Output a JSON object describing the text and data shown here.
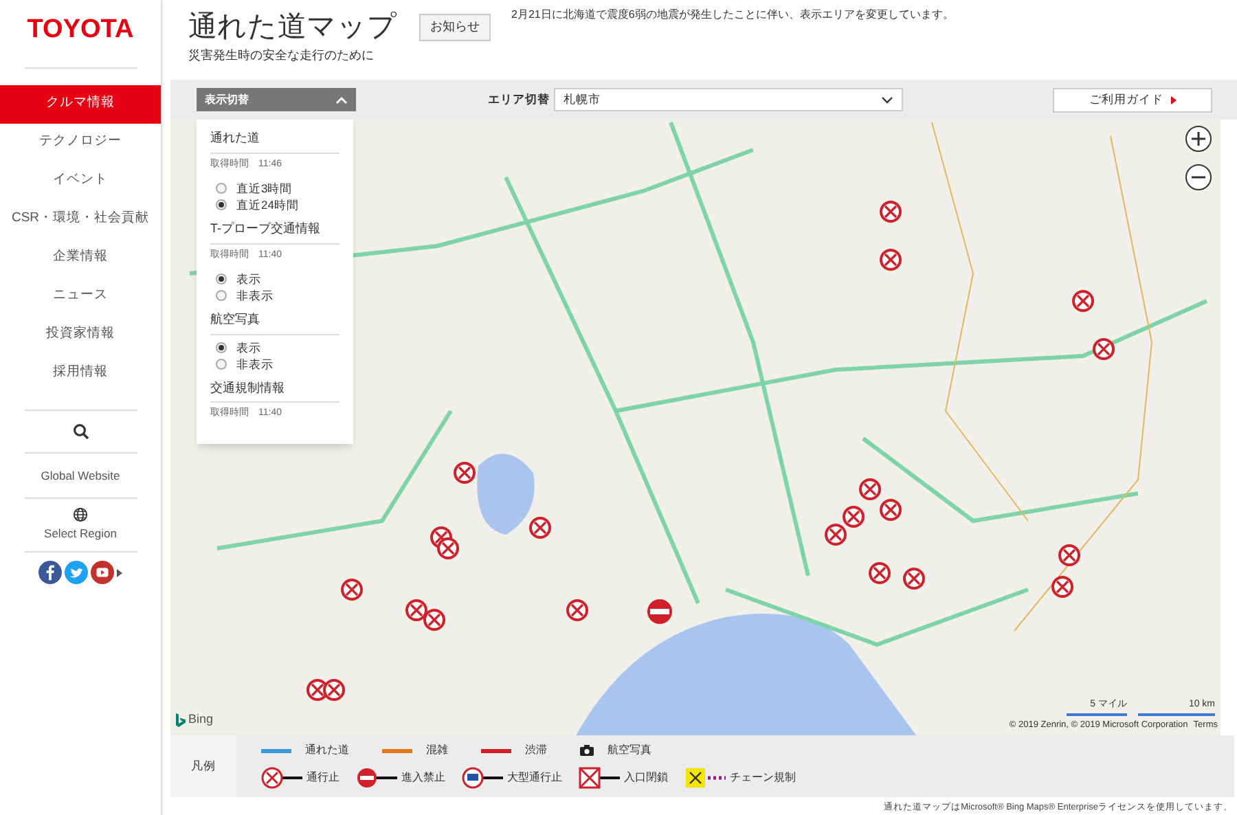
{
  "sidebar": {
    "logo": "TOYOTA",
    "items": [
      {
        "label": "クルマ情報",
        "selected": true
      },
      {
        "label": "テクノロジー",
        "selected": false
      },
      {
        "label": "イベント",
        "selected": false
      },
      {
        "label": "CSR・環境・社会貢献",
        "selected": false
      },
      {
        "label": "企業情報",
        "selected": false
      },
      {
        "label": "ニュース",
        "selected": false
      },
      {
        "label": "投資家情報",
        "selected": false
      },
      {
        "label": "採用情報",
        "selected": false
      }
    ],
    "global_website": "Global Website",
    "select_region": "Select Region"
  },
  "header": {
    "title": "通れた道マップ",
    "subtitle": "災害発生時の安全な走行のために",
    "notice_button": "お知らせ",
    "notice": "2月21日に北海道で震度6弱の地震が発生したことに伴い、表示エリアを変更しています。"
  },
  "toolbar": {
    "display_toggle": "表示切替",
    "area_label": "エリア切替",
    "area_value": "札幌市",
    "guide_button": "ご利用ガイド"
  },
  "panel": {
    "sections": [
      {
        "title": "通れた道",
        "time": "取得時間　11:46",
        "options": [
          {
            "label": "直近3時間",
            "selected": false
          },
          {
            "label": "直近24時間",
            "selected": true
          }
        ]
      },
      {
        "title": "T-プローブ交通情報",
        "time": "取得時間　11:40",
        "options": [
          {
            "label": "表示",
            "selected": true
          },
          {
            "label": "非表示",
            "selected": false
          }
        ]
      },
      {
        "title": "航空写真",
        "options": [
          {
            "label": "表示",
            "selected": true
          },
          {
            "label": "非表示",
            "selected": false
          }
        ]
      },
      {
        "title": "交通規制情報",
        "time": "取得時間　11:40"
      }
    ]
  },
  "map": {
    "scale_miles": "5 マイル",
    "scale_km": "10 km",
    "copyright": "© 2019 Zenrin, © 2019 Microsoft Corporation",
    "terms": "Terms",
    "bing": "Bing"
  },
  "legend": {
    "title": "凡例",
    "lines": [
      {
        "kind": "line",
        "label": "通れた道",
        "color": "#3a9ad9"
      },
      {
        "kind": "line",
        "label": "混雑",
        "color": "#e07b20"
      },
      {
        "kind": "line",
        "label": "渋滞",
        "color": "#d0202a"
      },
      {
        "kind": "camera",
        "label": "航空写真"
      }
    ],
    "markers": [
      {
        "kind": "closed",
        "label": "通行止"
      },
      {
        "kind": "no-entry",
        "label": "進入禁止"
      },
      {
        "kind": "large",
        "label": "大型通行止"
      },
      {
        "kind": "ramp",
        "label": "入口閉鎖"
      },
      {
        "kind": "chain",
        "label": "チェーン規制"
      }
    ]
  },
  "footer_note": "通れた道マップはMicrosoft® Bing Maps® Enterpriseライセンスを使用しています。"
}
